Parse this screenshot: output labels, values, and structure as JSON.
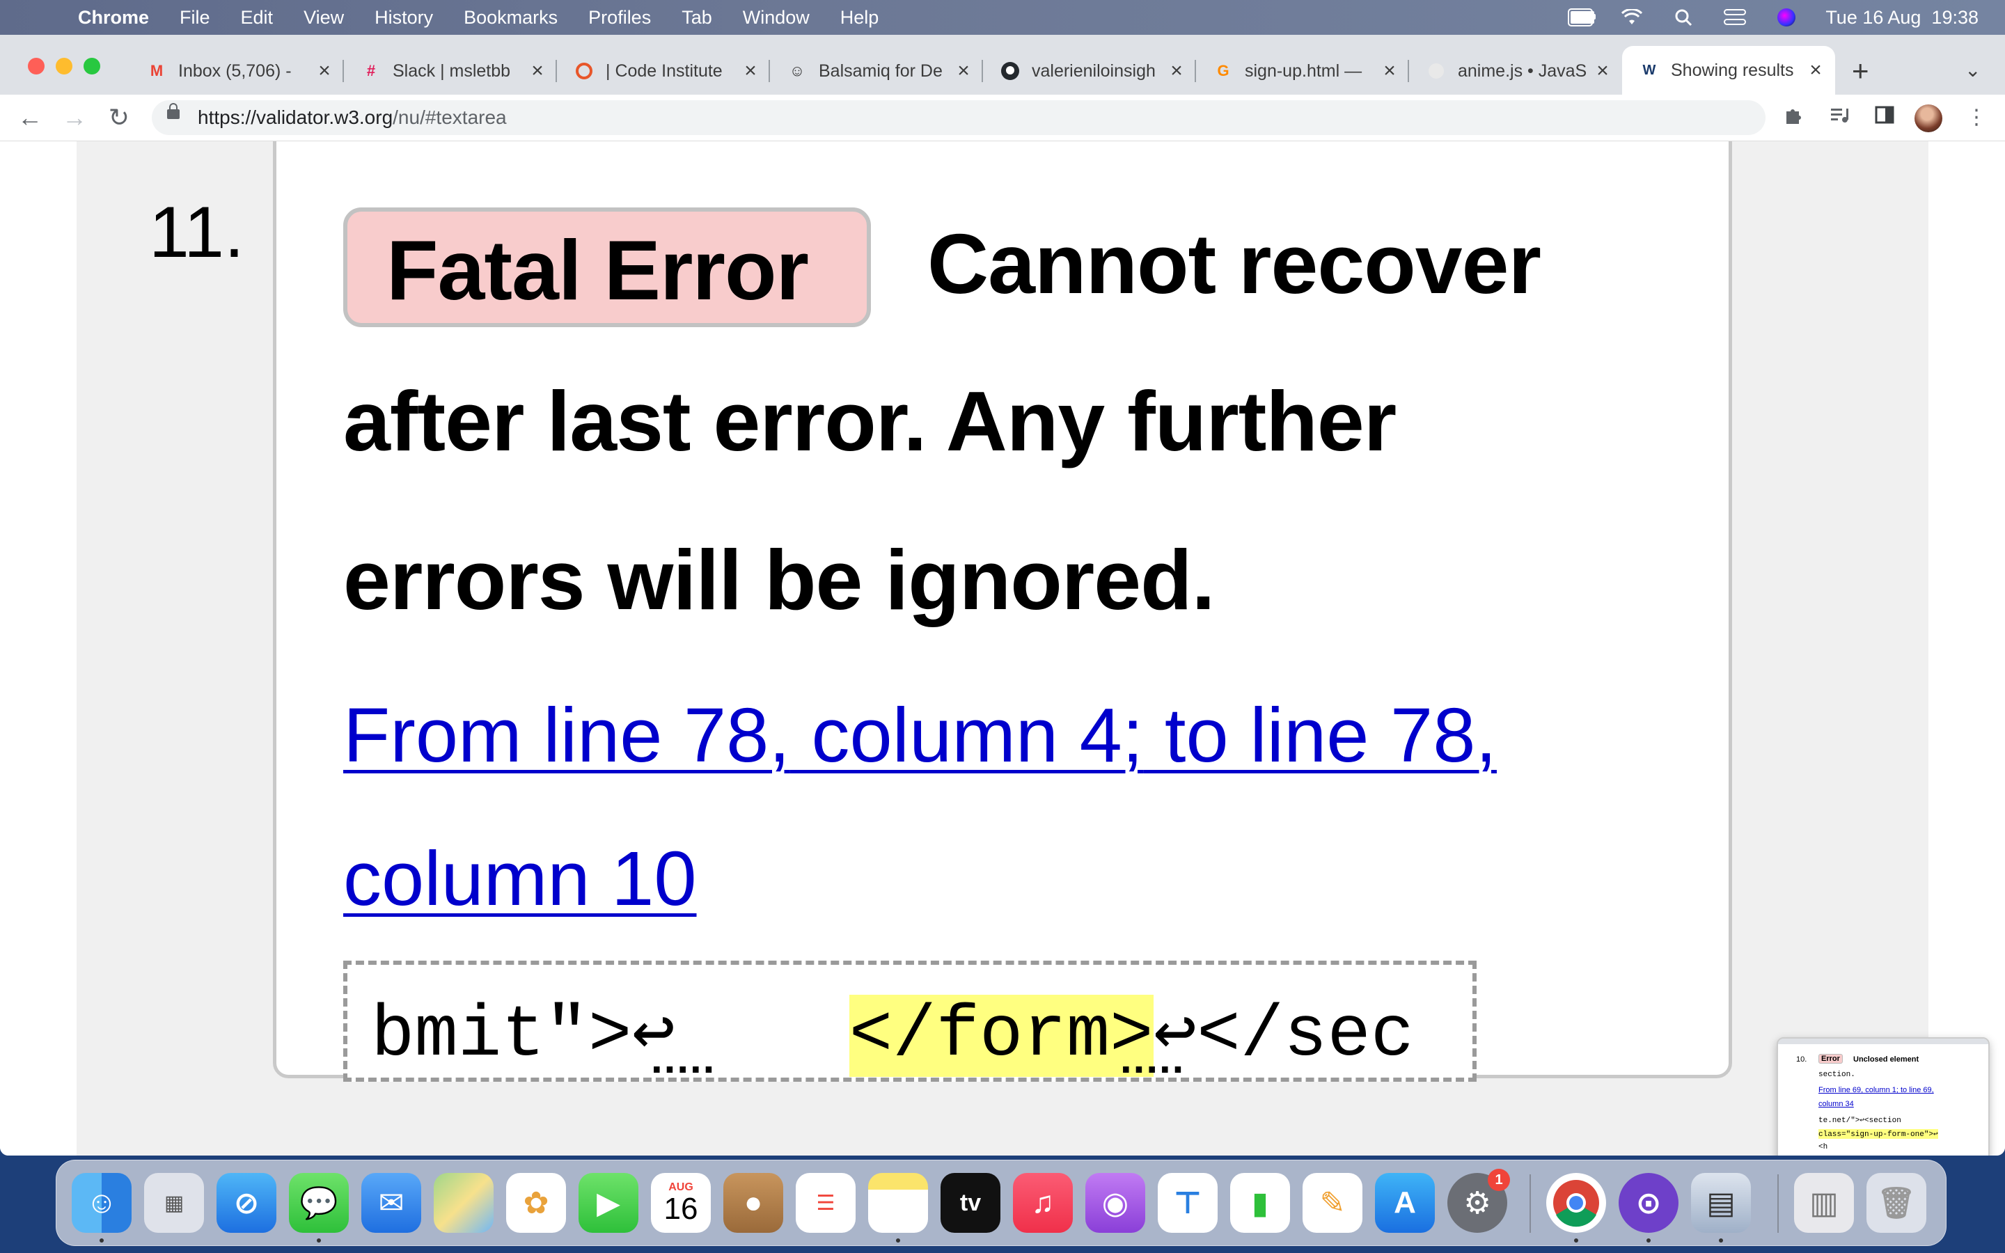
{
  "menubar": {
    "app_name": "Chrome",
    "items": [
      "File",
      "Edit",
      "View",
      "History",
      "Bookmarks",
      "Profiles",
      "Tab",
      "Window",
      "Help"
    ],
    "clock": "Tue 16 Aug  19:38"
  },
  "tabs": [
    {
      "title": "Inbox (5,706) -",
      "icon": "gmail-icon",
      "active": false
    },
    {
      "title": "Slack | msletbb",
      "icon": "slack-icon",
      "active": false
    },
    {
      "title": "| Code Institute",
      "icon": "code-institute-icon",
      "active": false
    },
    {
      "title": "Balsamiq for De",
      "icon": "balsamiq-icon",
      "active": false
    },
    {
      "title": "valerieniloinsigh",
      "icon": "github-icon",
      "active": false
    },
    {
      "title": "sign-up.html —",
      "icon": "gitpod-icon",
      "active": false
    },
    {
      "title": "anime.js • JavaS",
      "icon": "animejs-icon",
      "active": false
    },
    {
      "title": "Showing results",
      "icon": "w3c-validator-icon",
      "active": true
    }
  ],
  "address": {
    "host": "https://validator.w3.org",
    "path": "/nu/#textarea"
  },
  "message": {
    "number": "11.",
    "type_label": "Fatal Error",
    "line1": "Cannot recover",
    "line2": "after last error. Any further",
    "line3": "errors will be ignored.",
    "location_part1": "From line 78,",
    "location_part2": " column 4;",
    "location_part3": " to line 78,",
    "location_part4": "column 10",
    "extract_before": "bmit\">↩    ",
    "extract_highlight": "</form>",
    "extract_after": "↩</sec"
  },
  "thumbnail": {
    "number": "10.",
    "badge": "Error",
    "title": "Unclosed element",
    "code1": "section.",
    "link1": "From line 69, column 1; to line 69,",
    "link2": "column 34",
    "code2": "te.net/\">↩<section",
    "code3": "class=\"sign-up-form-one\">↩",
    "code4": "<h"
  },
  "dock": {
    "calendar_month": "AUG",
    "calendar_day": "16",
    "settings_badge": "1",
    "tv_label": "tv"
  }
}
